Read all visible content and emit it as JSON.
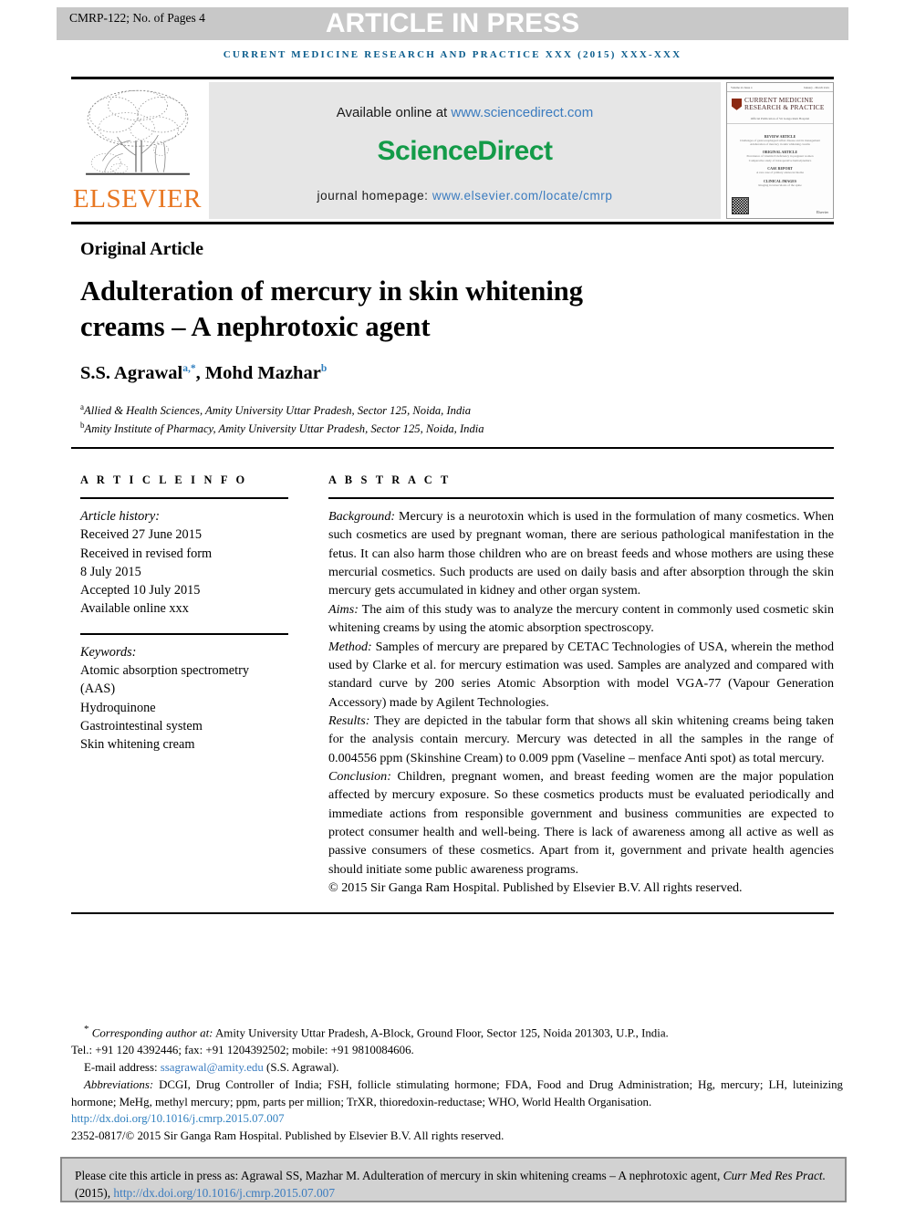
{
  "header": {
    "manuscript_id": "CMRP-122; No. of Pages 4",
    "article_in_press": "ARTICLE IN PRESS",
    "running_head": "CURRENT MEDICINE RESEARCH AND PRACTICE XXX (2015) XXX-XXX",
    "band_color": "#c8c8c8",
    "running_head_color": "#0a5c8c"
  },
  "masthead": {
    "publisher_name": "ELSEVIER",
    "publisher_color": "#E87722",
    "available_online_prefix": "Available online at ",
    "sciencedirect_url": "www.sciencedirect.com",
    "sciencedirect_logo": "ScienceDirect",
    "sciencedirect_color": "#139B48",
    "homepage_prefix": "journal homepage: ",
    "homepage_url": "www.elsevier.com/locate/cmrp",
    "link_color": "#3a7bbf",
    "cover": {
      "top_left": "Volume xx Issue x",
      "top_right": "January - March xxxx",
      "journal_name": "CURRENT MEDICINE RESEARCH & PRACTICE",
      "sub": "Official Publication of Sir Ganga Ram Hospital",
      "toc": [
        {
          "head": "REVIEW ARTICLE",
          "lines": [
            "Challenges of gastroesophageal reflux disease and its management",
            "Adulteration of mercury in skin whitening creams"
          ]
        },
        {
          "head": "ORIGINAL ARTICLE",
          "lines": [
            "Prevalence of vitamin D deficiency in pregnant women",
            "Comparative study of intraoperative hemodynamics"
          ]
        },
        {
          "head": "CASE REPORT",
          "lines": [
            "A rare case of primary adenocarcinoma",
            "Pulmonary alveolar microlithiasis"
          ]
        },
        {
          "head": "CLINICAL IMAGES",
          "lines": [
            "Imaging in tuberculosis of the spine"
          ]
        }
      ],
      "publisher": "Elsevier"
    }
  },
  "article": {
    "type": "Original Article",
    "title_line_1": "Adulteration of mercury in skin whitening",
    "title_line_2": "creams – A nephrotoxic agent",
    "authors": [
      {
        "name": "S.S. Agrawal",
        "marks": "a,*"
      },
      {
        "name": "Mohd Mazhar",
        "marks": "b"
      }
    ],
    "affiliations": [
      {
        "mark": "a",
        "text": "Allied & Health Sciences, Amity University Uttar Pradesh, Sector 125, Noida, India"
      },
      {
        "mark": "b",
        "text": "Amity Institute of Pharmacy, Amity University Uttar Pradesh, Sector 125, Noida, India"
      }
    ]
  },
  "article_info": {
    "heading": "A R T I C L E   I N F O",
    "history_label": "Article history:",
    "history": [
      "Received 27 June 2015",
      "Received in revised form",
      "8 July 2015",
      "Accepted 10 July 2015",
      "Available online xxx"
    ],
    "keywords_label": "Keywords:",
    "keywords": [
      "Atomic absorption spectrometry",
      "(AAS)",
      "Hydroquinone",
      "Gastrointestinal system",
      "Skin whitening cream"
    ]
  },
  "abstract": {
    "heading": "A B S T R A C T",
    "sections": [
      {
        "label": "Background:",
        "text": " Mercury is a neurotoxin which is used in the formulation of many cosmetics. When such cosmetics are used by pregnant woman, there are serious pathological manifestation in the fetus. It can also harm those children who are on breast feeds and whose mothers are using these mercurial cosmetics. Such products are used on daily basis and after absorption through the skin mercury gets accumulated in kidney and other organ system."
      },
      {
        "label": "Aims:",
        "text": " The aim of this study was to analyze the mercury content in commonly used cosmetic skin whitening creams by using the atomic absorption spectroscopy."
      },
      {
        "label": "Method:",
        "text": " Samples of mercury are prepared by CETAC Technologies of USA, wherein the method used by Clarke et al. for mercury estimation was used. Samples are analyzed and compared with standard curve by 200 series Atomic Absorption with model VGA-77 (Vapour Generation Accessory) made by Agilent Technologies."
      },
      {
        "label": "Results:",
        "text": " They are depicted in the tabular form that shows all skin whitening creams being taken for the analysis contain mercury. Mercury was detected in all the samples in the range of 0.004556 ppm (Skinshine Cream) to 0.009 ppm (Vaseline – menface Anti spot) as total mercury."
      },
      {
        "label": "Conclusion:",
        "text": " Children, pregnant women, and breast feeding women are the major population affected by mercury exposure. So these cosmetics products must be evaluated periodically and immediate actions from responsible government and business communities are expected to protect consumer health and well-being. There is lack of awareness among all active as well as passive consumers of these cosmetics. Apart from it, government and private health agencies should initiate some public awareness programs."
      }
    ],
    "copyright": "© 2015 Sir Ganga Ram Hospital. Published by Elsevier B.V. All rights reserved."
  },
  "footnotes": {
    "corresponding_label": "Corresponding author at:",
    "corresponding_address": " Amity University Uttar Pradesh, A-Block, Ground Floor, Sector 125, Noida 201303, U.P., India.",
    "contact_line": "Tel.: +91 120 4392446; fax: +91 1204392502; mobile: +91 9810084606.",
    "email_label": "E-mail address: ",
    "email": "ssagrawal@amity.edu",
    "email_suffix": " (S.S. Agrawal).",
    "abbreviations_label": "Abbreviations:",
    "abbreviations_text": " DCGI, Drug Controller of India; FSH, follicle stimulating hormone; FDA, Food and Drug Administration; Hg, mercury; LH, luteinizing hormone; MeHg, methyl mercury; ppm, parts per million; TrXR, thioredoxin-reductase; WHO, World Health Organisation.",
    "doi": "http://dx.doi.org/10.1016/j.cmrp.2015.07.007",
    "issn_line": "2352-0817/© 2015 Sir Ganga Ram Hospital. Published by Elsevier B.V. All rights reserved."
  },
  "cite_box": {
    "text_before": "Please cite this article in press as: Agrawal  SS, Mazhar  M. Adulteration of mercury in skin whitening creams – A nephrotoxic agent, ",
    "journal_italic": "Curr Med Res Pract.",
    "year": " (2015), ",
    "doi": "http://dx.doi.org/10.1016/j.cmrp.2015.07.007"
  }
}
